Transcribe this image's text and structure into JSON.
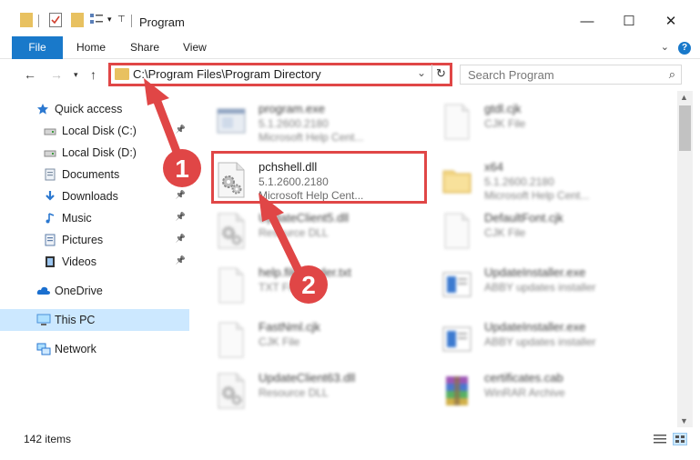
{
  "window": {
    "title": "Program",
    "controls": {
      "minimize": "—",
      "maximize": "☐",
      "close": "✕"
    }
  },
  "ribbon": {
    "tabs": [
      "File",
      "Home",
      "Share",
      "View"
    ],
    "help": "?"
  },
  "address_bar": {
    "path": "C:\\Program Files\\Program Directory",
    "search_placeholder": "Search Program"
  },
  "sidebar": {
    "items": [
      {
        "label": "Quick access",
        "icon": "star-icon",
        "pinned": false
      },
      {
        "label": "Local Disk (C:)",
        "icon": "drive-icon",
        "pinned": true
      },
      {
        "label": "Local Disk (D:)",
        "icon": "drive-icon",
        "pinned": false
      },
      {
        "label": "Documents",
        "icon": "documents-icon",
        "pinned": true
      },
      {
        "label": "Downloads",
        "icon": "download-icon",
        "pinned": true
      },
      {
        "label": "Music",
        "icon": "music-icon",
        "pinned": true
      },
      {
        "label": "Pictures",
        "icon": "pictures-icon",
        "pinned": true
      },
      {
        "label": "Videos",
        "icon": "videos-icon",
        "pinned": true
      },
      {
        "label": "OneDrive",
        "icon": "cloud-icon",
        "pinned": false
      },
      {
        "label": "This PC",
        "icon": "computer-icon",
        "pinned": false,
        "selected": true
      },
      {
        "label": "Network",
        "icon": "network-icon",
        "pinned": false
      }
    ]
  },
  "files": [
    {
      "name": "program.exe",
      "line1": "5.1.2600.2180",
      "line2": "Microsoft Help Cent...",
      "icon": "exe-icon",
      "blurred": true
    },
    {
      "name": "gtdl.cjk",
      "line1": "CJK File",
      "line2": "",
      "icon": "document-icon",
      "blurred": true
    },
    {
      "name": "pchshell.dll",
      "line1": "5.1.2600.2180",
      "line2": "Microsoft Help Cent...",
      "icon": "dll-gear-icon",
      "blurred": false
    },
    {
      "name": "x64",
      "line1": "5.1.2600.2180",
      "line2": "Microsoft Help Cent...",
      "icon": "folder-icon",
      "blurred": true
    },
    {
      "name": "UpdateClient5.dll",
      "line1": "Resource DLL",
      "line2": "",
      "icon": "dll-gear-icon",
      "blurred": true
    },
    {
      "name": "DefaultFont.cjk",
      "line1": "CJK File",
      "line2": "",
      "icon": "document-icon",
      "blurred": true
    },
    {
      "name": "help.fileheader.txt",
      "line1": "TXT File",
      "line2": "",
      "icon": "document-icon",
      "blurred": true
    },
    {
      "name": "UpdateInstaller.exe",
      "line1": "ABBY updates installer",
      "line2": "",
      "icon": "installer-icon",
      "blurred": true
    },
    {
      "name": "FastNml.cjk",
      "line1": "CJK File",
      "line2": "",
      "icon": "document-icon",
      "blurred": true
    },
    {
      "name": "UpdateInstaller.exe",
      "line1": "ABBY updates installer",
      "line2": "",
      "icon": "installer-icon",
      "blurred": true
    },
    {
      "name": "UpdateClient63.dll",
      "line1": "Resource DLL",
      "line2": "",
      "icon": "dll-gear-icon",
      "blurred": true
    },
    {
      "name": "certificates.cab",
      "line1": "WinRAR Archive",
      "line2": "",
      "icon": "archive-icon",
      "blurred": true
    }
  ],
  "annotations": {
    "step1": "1",
    "step2": "2",
    "color": "#e04646"
  },
  "status": {
    "count": "142 items"
  },
  "colors": {
    "accent": "#1979ca",
    "selected": "#cce8ff",
    "highlight": "#e04646"
  }
}
